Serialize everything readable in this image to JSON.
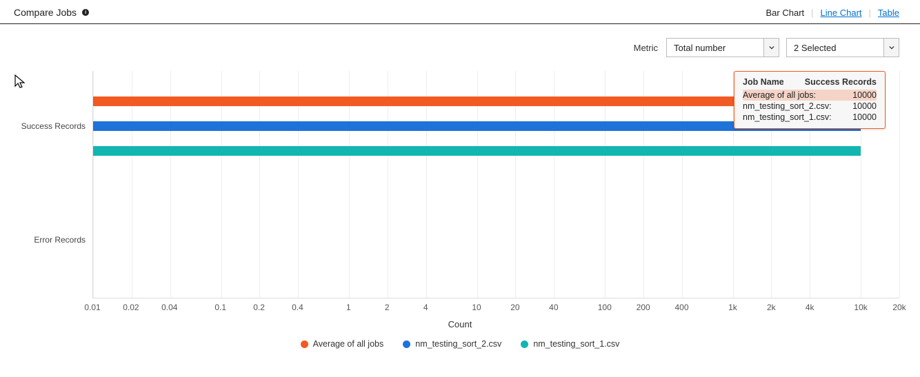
{
  "header": {
    "title": "Compare Jobs",
    "view_modes": {
      "bar_chart": "Bar Chart",
      "line_chart": "Line Chart",
      "table": "Table"
    }
  },
  "controls": {
    "metric_label": "Metric",
    "metric_selected": "Total number",
    "jobs_selected": "2 Selected"
  },
  "legend": {
    "s0": "Average of all jobs",
    "s1": "nm_testing_sort_2.csv",
    "s2": "nm_testing_sort_1.csv"
  },
  "colors": {
    "s0": "#f15a22",
    "s1": "#1e73d9",
    "s2": "#13b5b1"
  },
  "y_categories": {
    "success": "Success Records",
    "error": "Error Records"
  },
  "xlabel": "Count",
  "ticks": [
    "0.01",
    "0.02",
    "0.04",
    "0.1",
    "0.2",
    "0.4",
    "1",
    "2",
    "4",
    "10",
    "20",
    "40",
    "100",
    "200",
    "400",
    "1k",
    "2k",
    "4k",
    "10k",
    "20k"
  ],
  "tooltip": {
    "col1": "Job Name",
    "col2": "Success Records",
    "rows": [
      {
        "name": "Average of all jobs",
        "value": "10000",
        "highlight": true
      },
      {
        "name": "nm_testing_sort_2.csv",
        "value": "10000",
        "highlight": false
      },
      {
        "name": "nm_testing_sort_1.csv",
        "value": "10000",
        "highlight": false
      }
    ]
  },
  "chart_data": {
    "type": "bar",
    "orientation": "horizontal",
    "x_scale": "log",
    "xlabel": "Count",
    "xlim": [
      0.01,
      20000
    ],
    "ticks_numeric": [
      0.01,
      0.02,
      0.04,
      0.1,
      0.2,
      0.4,
      1,
      2,
      4,
      10,
      20,
      40,
      100,
      200,
      400,
      1000,
      2000,
      4000,
      10000,
      20000
    ],
    "categories": [
      "Success Records",
      "Error Records"
    ],
    "series": [
      {
        "name": "Average of all jobs",
        "color": "#f15a22",
        "values": [
          10000,
          0
        ]
      },
      {
        "name": "nm_testing_sort_2.csv",
        "color": "#1e73d9",
        "values": [
          10000,
          0
        ]
      },
      {
        "name": "nm_testing_sort_1.csv",
        "color": "#13b5b1",
        "values": [
          10000,
          0
        ]
      }
    ]
  }
}
